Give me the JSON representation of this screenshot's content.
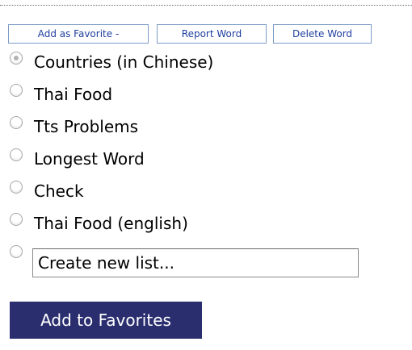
{
  "toolbar": {
    "favorite_label": "Add as Favorite -",
    "report_label": "Report Word",
    "delete_label": "Delete Word"
  },
  "lists": {
    "items": [
      {
        "label": "Countries (in Chinese)",
        "selected": true
      },
      {
        "label": "Thai Food",
        "selected": false
      },
      {
        "label": "Tts Problems",
        "selected": false
      },
      {
        "label": "Longest Word",
        "selected": false
      },
      {
        "label": "Check",
        "selected": false
      },
      {
        "label": "Thai Food (english)",
        "selected": false
      }
    ],
    "new_list_value": "Create new list..."
  },
  "submit_label": "Add to Favorites",
  "colors": {
    "button_border": "#7c9cc6",
    "button_text": "#1f3f9f",
    "submit_bg": "#2a2e6f",
    "submit_text": "#ffffff"
  }
}
